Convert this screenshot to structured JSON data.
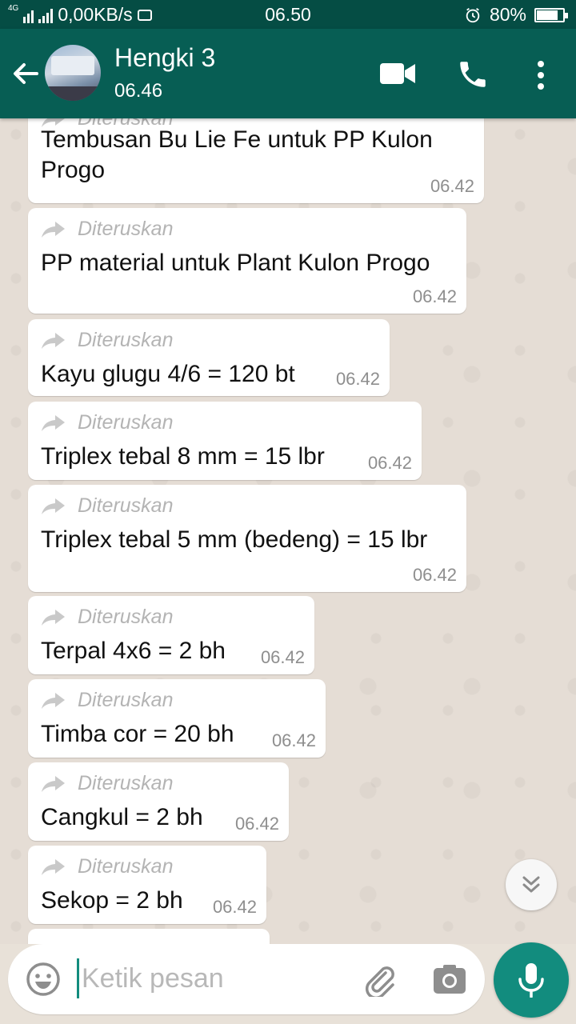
{
  "status_bar": {
    "network": "4G",
    "speed": "0,00KB/s",
    "clock": "06.50",
    "battery": "80%",
    "battery_level": 0.8
  },
  "header": {
    "back_icon": "arrow-left-icon",
    "contact_name": "Hengki 3",
    "last_seen": "06.46",
    "icons": [
      "video-call-icon",
      "phone-icon",
      "more-vert-icon"
    ]
  },
  "messages": [
    {
      "forwarded_label": "Diteruskan",
      "lines": [
        "Tembusan Bu Lie Fe untuk PP Kulon",
        "Progo"
      ],
      "time": "06.42"
    },
    {
      "forwarded_label": "Diteruskan",
      "lines": [
        "PP material untuk Plant Kulon Progo"
      ],
      "time": "06.42"
    },
    {
      "forwarded_label": "Diteruskan",
      "lines": [
        "Kayu glugu 4/6 = 120 bt"
      ],
      "time": "06.42"
    },
    {
      "forwarded_label": "Diteruskan",
      "lines": [
        "Triplex tebal 8 mm = 15 lbr"
      ],
      "time": "06.42"
    },
    {
      "forwarded_label": "Diteruskan",
      "lines": [
        "Triplex tebal 5 mm (bedeng) = 15 lbr"
      ],
      "time": "06.42"
    },
    {
      "forwarded_label": "Diteruskan",
      "lines": [
        "Terpal 4x6 = 2 bh"
      ],
      "time": "06.42"
    },
    {
      "forwarded_label": "Diteruskan",
      "lines": [
        "Timba cor = 20 bh"
      ],
      "time": "06.42"
    },
    {
      "forwarded_label": "Diteruskan",
      "lines": [
        "Cangkul = 2 bh"
      ],
      "time": "06.42"
    },
    {
      "forwarded_label": "Diteruskan",
      "lines": [
        "Sekop = 2 bh"
      ],
      "time": "06.42"
    }
  ],
  "composer": {
    "placeholder": "Ketik pesan",
    "icons": [
      "emoji-icon",
      "attach-icon",
      "camera-icon",
      "mic-icon"
    ]
  },
  "colors": {
    "header": "#075e54",
    "status_bar": "#054d44",
    "accent": "#128c7e",
    "chat_bg": "#e5ddd5",
    "bubble": "#ffffff"
  }
}
